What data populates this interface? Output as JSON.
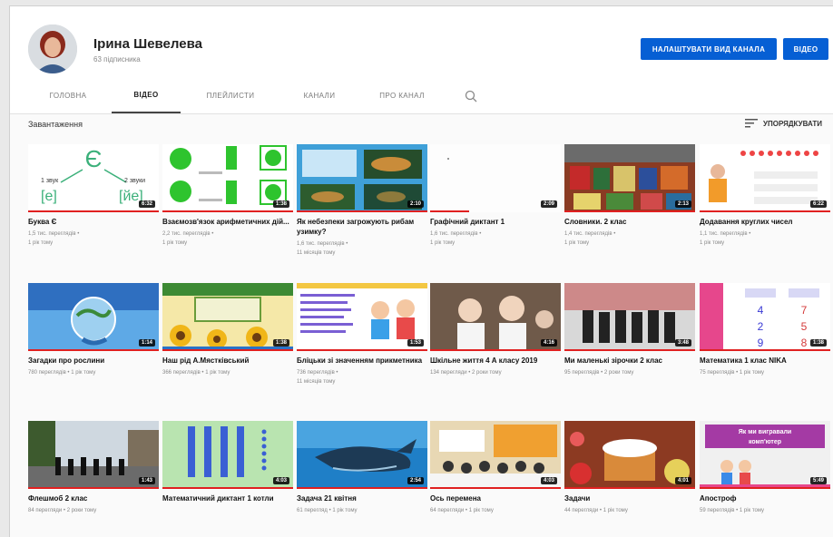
{
  "channel": {
    "name": "Ірина Шевелева",
    "subscribers": "63 підписника",
    "customize_label": "НАЛАШТУВАТИ ВИД КАНАЛА",
    "video_label": "ВІДЕО"
  },
  "tabs": [
    "ГОЛОВНА",
    "ВІДЕО",
    "ПЛЕЙЛИСТИ",
    "КАНАЛИ",
    "ПРО КАНАЛ"
  ],
  "uploads": {
    "title": "Завантаження",
    "sort_label": "УПОРЯДКУВАТИ"
  },
  "videos": [
    {
      "title": "Буква Є",
      "views": "1,5 тис. переглядів",
      "age": "1 рік тому",
      "duration": "6:32",
      "progress": 1.0,
      "thumb": "letter"
    },
    {
      "title": "Взаємозв'язок арифметичних дій...",
      "views": "2,2 тис. переглядів",
      "age": "1 рік тому",
      "duration": "1:38",
      "progress": 1.0,
      "thumb": "circles"
    },
    {
      "title": "Як небезпеки загрожують рибам узимку?",
      "views": "1,6 тис. переглядів",
      "age": "11 місяців тому",
      "duration": "2:10",
      "progress": 1.0,
      "thumb": "fish"
    },
    {
      "title": "Графічний диктант 1",
      "views": "1,6 тис. переглядів",
      "age": "1 рік тому",
      "duration": "2:09",
      "progress": 0.3,
      "thumb": "blank"
    },
    {
      "title": "Словники. 2 клас",
      "views": "1,4 тис. переглядів",
      "age": "1 рік тому",
      "duration": "2:13",
      "progress": 1.0,
      "thumb": "books"
    },
    {
      "title": "Додавання круглих чисел",
      "views": "1,1 тис. переглядів",
      "age": "1 рік тому",
      "duration": "6:22",
      "progress": 1.0,
      "thumb": "math"
    },
    {
      "title": "Загадки про рослини",
      "views": "780 переглядів",
      "age": "1 рік тому",
      "duration": "1:14",
      "progress": 1.0,
      "thumb": "globe"
    },
    {
      "title": "Наш рід А.Мястківський",
      "views": "366 переглядів",
      "age": "1 рік тому",
      "duration": "1:38",
      "progress": 1.0,
      "thumb": "flowers"
    },
    {
      "title": "Бліцьки зі значенням прикметника",
      "views": "736 переглядів",
      "age": "11 місяців тому",
      "duration": "1:53",
      "progress": 1.0,
      "thumb": "kids"
    },
    {
      "title": "Шкільне життя 4 А класу 2019",
      "views": "134 перегляди",
      "age": "2 роки тому",
      "duration": "4:16",
      "progress": 1.0,
      "thumb": "girls"
    },
    {
      "title": "Ми маленькі зірочки 2 клас",
      "views": "95 переглядів",
      "age": "2 роки тому",
      "duration": "3:48",
      "progress": 1.0,
      "thumb": "class"
    },
    {
      "title": "Математика 1 клас NIKA",
      "views": "75 переглядів",
      "age": "1 рік тому",
      "duration": "1:38",
      "progress": 1.0,
      "thumb": "numbers"
    },
    {
      "title": "Флешмоб 2 клас",
      "views": "84 перегляди",
      "age": "2 роки тому",
      "duration": "1:43",
      "progress": 1.0,
      "thumb": "yard"
    },
    {
      "title": "Математичний диктант 1 котли",
      "views": "",
      "age": "",
      "duration": "4:03",
      "progress": 1.0,
      "thumb": "sticks"
    },
    {
      "title": "Задача 21 квітня",
      "views": "61 перегляд",
      "age": "1 рік тому",
      "duration": "2:54",
      "progress": 1.0,
      "thumb": "whale"
    },
    {
      "title": "Ось перемена",
      "views": "64 перегляди",
      "age": "1 рік тому",
      "duration": "4:03",
      "progress": 1.0,
      "thumb": "hall"
    },
    {
      "title": "Задачи",
      "views": "44 перегляди",
      "age": "1 рік тому",
      "duration": "4:01",
      "progress": 1.0,
      "thumb": "cake"
    },
    {
      "title": "Апостроф",
      "views": "59 переглядів",
      "age": "1 рік тому",
      "duration": "5:49",
      "progress": 1.0,
      "thumb": "banner"
    }
  ],
  "thumb_text": {
    "letter_big": "Є",
    "letter_left": "[е]",
    "letter_right": "[йе]",
    "letter_label_left": "1 звук",
    "letter_label_right": "2 звуки",
    "banner_line1": "Як ми вигравали",
    "banner_line2": "комп'ютер"
  },
  "colors": {
    "accent": "#065fd4",
    "progress": "#e02020"
  }
}
